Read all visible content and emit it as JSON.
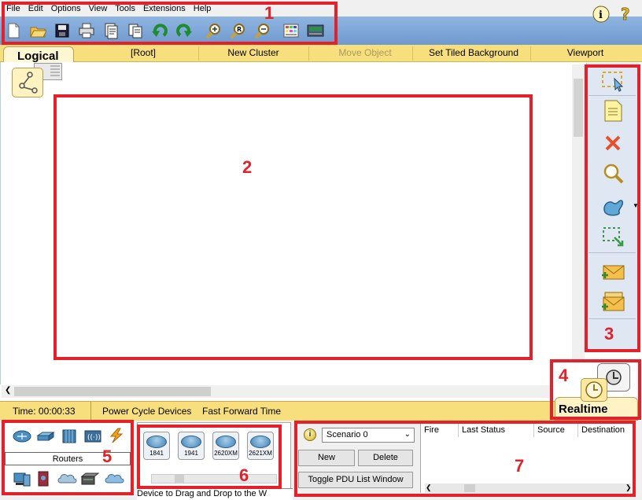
{
  "menu": [
    "File",
    "Edit",
    "Options",
    "View",
    "Tools",
    "Extensions",
    "Help"
  ],
  "toolbar_icons": [
    "new-file-icon",
    "open-folder-icon",
    "save-icon",
    "print-icon",
    "activity-wizard-icon",
    "copy-icon",
    "undo-icon",
    "redo-icon",
    "zoom-in-icon",
    "zoom-reset-icon",
    "zoom-out-icon",
    "palette-icon",
    "custom-device-icon"
  ],
  "tabs": {
    "logical": "Logical",
    "root": "[Root]",
    "new_cluster": "New Cluster",
    "move_object": "Move Object",
    "set_tiled_background": "Set Tiled Background",
    "viewport": "Viewport"
  },
  "realtime": "Realtime",
  "status": {
    "time": "Time: 00:00:33",
    "power_cycle": "Power Cycle Devices",
    "fast_forward": "Fast Forward Time"
  },
  "device_category": "Routers",
  "routers": [
    "1841",
    "1941",
    "2620XM",
    "2621XM"
  ],
  "drag_hint": "Device to Drag and Drop to the W",
  "scenario": {
    "selected": "Scenario 0",
    "new": "New",
    "delete": "Delete",
    "toggle": "Toggle PDU List Window"
  },
  "pdu_columns": [
    "Fire",
    "Last Status",
    "Source",
    "Destination"
  ],
  "annotations": [
    "1",
    "2",
    "3",
    "4",
    "5",
    "6",
    "7"
  ],
  "colors": {
    "annotation": "#e4202a",
    "tab_bar": "#f8df7e",
    "toolbar": "#7ea6d8"
  }
}
